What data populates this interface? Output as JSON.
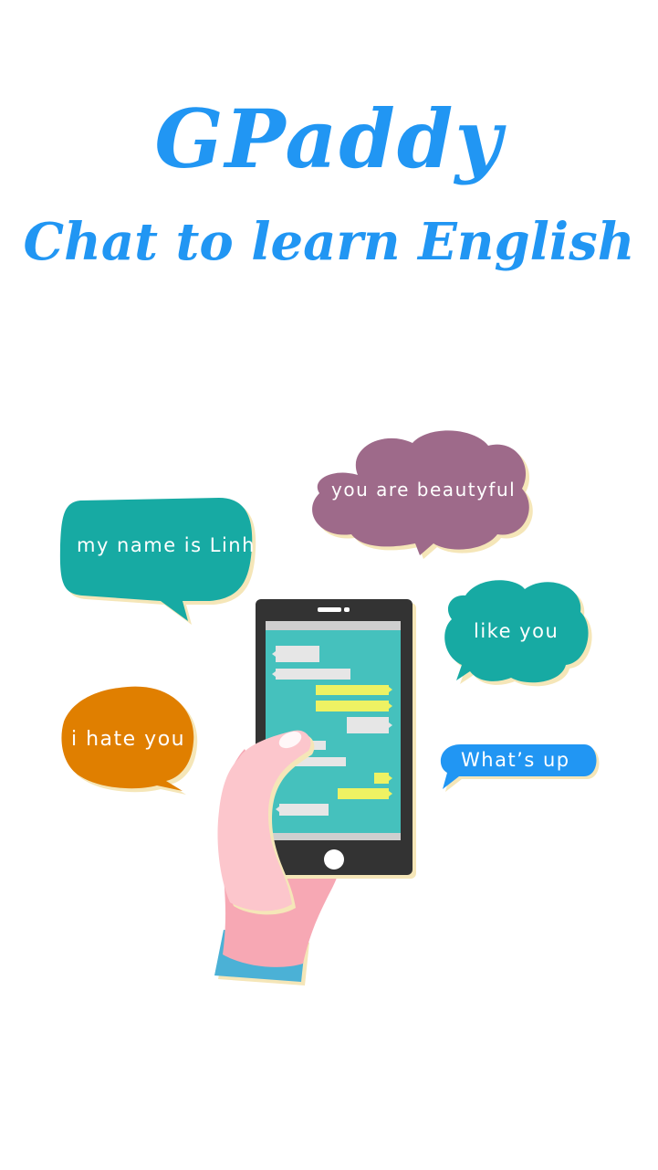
{
  "splash": {
    "title": "GPaddy",
    "subtitle": "Chat to learn English"
  },
  "bubbles": {
    "my_name": "my name is Linh",
    "beautiful": "you are beautyful",
    "like": "like you",
    "hate": "i hate you",
    "whats_up": "What’s up"
  },
  "colors": {
    "title_blue": "#2196f3",
    "teal": "#17aaa3",
    "purple": "#9e6a8a",
    "orange": "#e07f00",
    "blue": "#2196f3",
    "screen": "#45c1bd",
    "chat_yellow": "#eef263",
    "chat_gray": "#e6e6e6",
    "hand_pink": "#fcc6cc",
    "sleeve_blue": "#4bb1d6"
  }
}
